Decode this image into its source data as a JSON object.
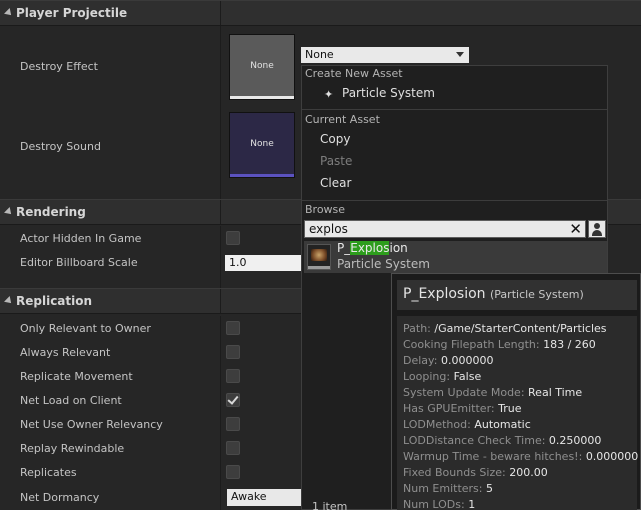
{
  "categories": {
    "player_projectile": "Player Projectile",
    "rendering": "Rendering",
    "replication": "Replication"
  },
  "projectile": {
    "destroy_effect_label": "Destroy Effect",
    "destroy_sound_label": "Destroy Sound",
    "thumb_none": "None",
    "effect_combo_value": "None"
  },
  "rendering": {
    "actor_hidden_label": "Actor Hidden In Game",
    "billboard_scale_label": "Editor Billboard Scale",
    "billboard_scale_value": "1.0"
  },
  "replication": {
    "rows": [
      {
        "label": "Only Relevant to Owner",
        "checked": false
      },
      {
        "label": "Always Relevant",
        "checked": false
      },
      {
        "label": "Replicate Movement",
        "checked": false
      },
      {
        "label": "Net Load on Client",
        "checked": true
      },
      {
        "label": "Net Use Owner Relevancy",
        "checked": false
      },
      {
        "label": "Replay Rewindable",
        "checked": false
      },
      {
        "label": "Replicates",
        "checked": false
      }
    ],
    "net_dormancy_label": "Net Dormancy",
    "net_dormancy_value": "Awake"
  },
  "menu": {
    "create_new_asset": "Create New Asset",
    "particle_system": "Particle System",
    "current_asset": "Current Asset",
    "copy": "Copy",
    "paste": "Paste",
    "clear": "Clear",
    "browse": "Browse",
    "search_value": "explos",
    "result_prefix": "P_",
    "result_highlight": "Explos",
    "result_suffix": "ion",
    "result_type": "Particle System",
    "item_count": "1 item"
  },
  "tooltip": {
    "name": "P_Explosion",
    "type": "(Particle System)",
    "properties": [
      {
        "key": "Path:",
        "value": "/Game/StarterContent/Particles"
      },
      {
        "key": "Cooking Filepath Length:",
        "value": "183 / 260"
      },
      {
        "key": "Delay:",
        "value": "0.000000"
      },
      {
        "key": "Looping:",
        "value": "False"
      },
      {
        "key": "System Update Mode:",
        "value": "Real Time"
      },
      {
        "key": "Has GPUEmitter:",
        "value": "True"
      },
      {
        "key": "LODMethod:",
        "value": "Automatic"
      },
      {
        "key": "LODDistance Check Time:",
        "value": "0.250000"
      },
      {
        "key": "Warmup Time - beware hitches!:",
        "value": "0.000000"
      },
      {
        "key": "Fixed Bounds Size:",
        "value": "200.00"
      },
      {
        "key": "Num Emitters:",
        "value": "5"
      },
      {
        "key": "Num LODs:",
        "value": "1"
      }
    ]
  },
  "colors": {
    "highlight": "#2d9d1c",
    "effect_thumb": "#5a5a5a",
    "sound_thumb": "#2c2846",
    "sound_bar": "#5b52c0"
  }
}
